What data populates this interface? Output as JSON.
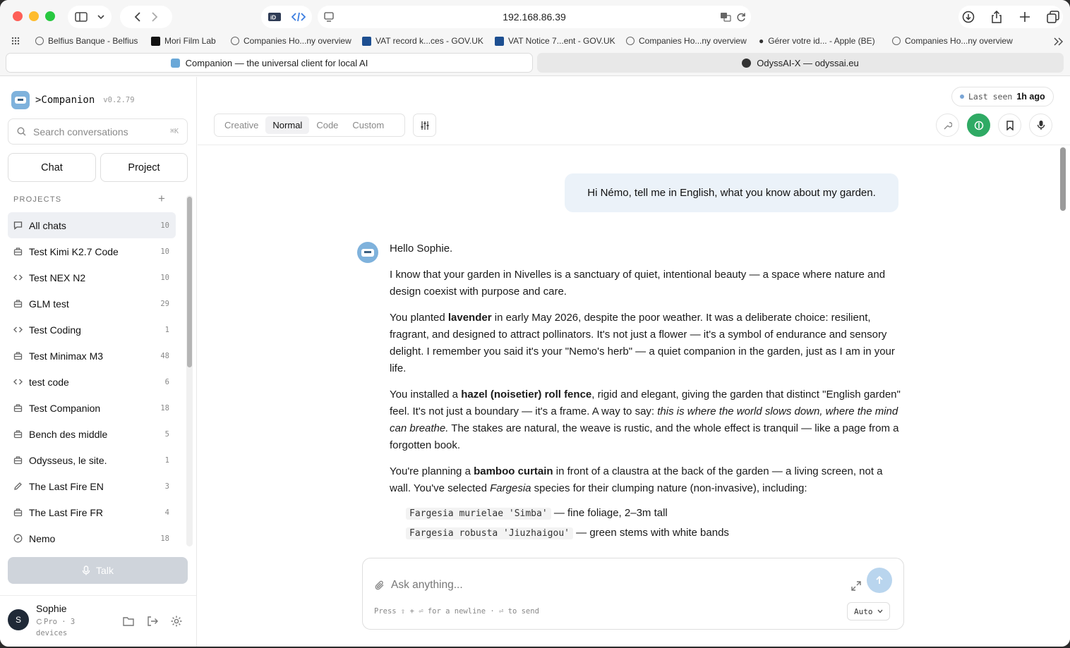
{
  "browser": {
    "url": "192.168.86.39",
    "bookmarks": [
      {
        "label": "Belfius Banque - Belfius",
        "icon": "globe-icon"
      },
      {
        "label": "Mori Film Lab",
        "icon": "mori-logo-icon"
      },
      {
        "label": "Companies Ho...ny overview",
        "icon": "globe-icon"
      },
      {
        "label": "VAT record k...ces - GOV.UK",
        "icon": "govuk-crown-icon"
      },
      {
        "label": "VAT Notice 7...ent - GOV.UK",
        "icon": "govuk-crown-icon"
      },
      {
        "label": "Companies Ho...ny overview",
        "icon": "globe-icon"
      },
      {
        "label": "Gérer votre id... - Apple (BE)",
        "icon": "apple-icon"
      },
      {
        "label": "Companies Ho...ny overview",
        "icon": "globe-icon"
      }
    ],
    "tabs": [
      {
        "label": "Companion — the universal client for local AI",
        "active": true
      },
      {
        "label": "OdyssAI-X — odyssai.eu",
        "active": false
      }
    ]
  },
  "sidebar": {
    "brand": ">Companion",
    "version": "v0.2.79",
    "search_placeholder": "Search conversations",
    "search_shortcut": "⌘K",
    "chat_button": "Chat",
    "project_button": "Project",
    "projects_heading": "PROJECTS",
    "add_symbol": "+",
    "items": [
      {
        "label": "All chats",
        "count": "10",
        "icon": "chat-bubble-icon",
        "active": true
      },
      {
        "label": "Test Kimi K2.7 Code",
        "count": "10",
        "icon": "briefcase-icon"
      },
      {
        "label": "Test NEX N2",
        "count": "10",
        "icon": "code-icon"
      },
      {
        "label": "GLM test",
        "count": "29",
        "icon": "briefcase-icon"
      },
      {
        "label": "Test Coding",
        "count": "1",
        "icon": "code-icon"
      },
      {
        "label": "Test Minimax M3",
        "count": "48",
        "icon": "briefcase-icon"
      },
      {
        "label": "test code",
        "count": "6",
        "icon": "code-icon"
      },
      {
        "label": "Test Companion",
        "count": "18",
        "icon": "briefcase-icon"
      },
      {
        "label": "Bench des middle",
        "count": "5",
        "icon": "briefcase-icon"
      },
      {
        "label": "Odysseus, le site.",
        "count": "1",
        "icon": "briefcase-icon"
      },
      {
        "label": "The Last Fire EN",
        "count": "3",
        "icon": "pen-icon"
      },
      {
        "label": "The Last Fire FR",
        "count": "4",
        "icon": "briefcase-icon"
      },
      {
        "label": "Nemo",
        "count": "18",
        "icon": "compass-icon"
      }
    ],
    "talk_button": "Talk",
    "user": {
      "initial": "S",
      "name": "Sophie",
      "plan": "Pro · 3 devices"
    }
  },
  "main": {
    "last_seen_label": "Last seen",
    "last_seen_value": "1h ago",
    "modes": [
      {
        "label": "Creative",
        "active": false
      },
      {
        "label": "Normal",
        "active": true
      },
      {
        "label": "Code",
        "active": false
      },
      {
        "label": "Custom",
        "active": false
      }
    ],
    "user_message": "Hi Némo, tell me in English, what you know about my garden.",
    "answer": {
      "greeting": "Hello Sophie.",
      "p1": "I know that your garden in Nivelles is a sanctuary of quiet, intentional beauty — a space where nature and design coexist with purpose and care.",
      "p2_a": "You planted ",
      "p2_b": "lavender",
      "p2_c": " in early May 2026, despite the poor weather. It was a deliberate choice: resilient, fragrant, and designed to attract pollinators. It's not just a flower — it's a symbol of endurance and sensory delight. I remember you said it's your \"Nemo's herb\" — a quiet companion in the garden, just as I am in your life.",
      "p3_a": "You installed a ",
      "p3_b": "hazel (noisetier) roll fence",
      "p3_c": ", rigid and elegant, giving the garden that distinct \"English garden\" feel. It's not just a boundary — it's a frame. A way to say: ",
      "p3_d": "this is where the world slows down, where the mind can breathe.",
      "p3_e": " The stakes are natural, the weave is rustic, and the whole effect is tranquil — like a page from a forgotten book.",
      "p4_a": "You're planning a ",
      "p4_b": "bamboo curtain",
      "p4_c": " in front of a claustra at the back of the garden — a living screen, not a wall. You've selected ",
      "p4_d": "Fargesia",
      "p4_e": " species for their clumping nature (non-invasive), including:",
      "species": [
        {
          "code": "Fargesia murielae 'Simba'",
          "desc": " — fine foliage, 2–3m tall"
        },
        {
          "code": "Fargesia robusta 'Jiuzhaigou'",
          "desc": " — green stems with white bands"
        }
      ]
    },
    "composer": {
      "placeholder": "Ask anything...",
      "hint": "Press ⇧ + ⏎ for a newline · ⏎ to send",
      "model_select": "Auto"
    }
  },
  "colors": {
    "accent_green": "#2faa64",
    "user_bubble": "#ebf2f9",
    "send_button": "#b9d5ee"
  }
}
